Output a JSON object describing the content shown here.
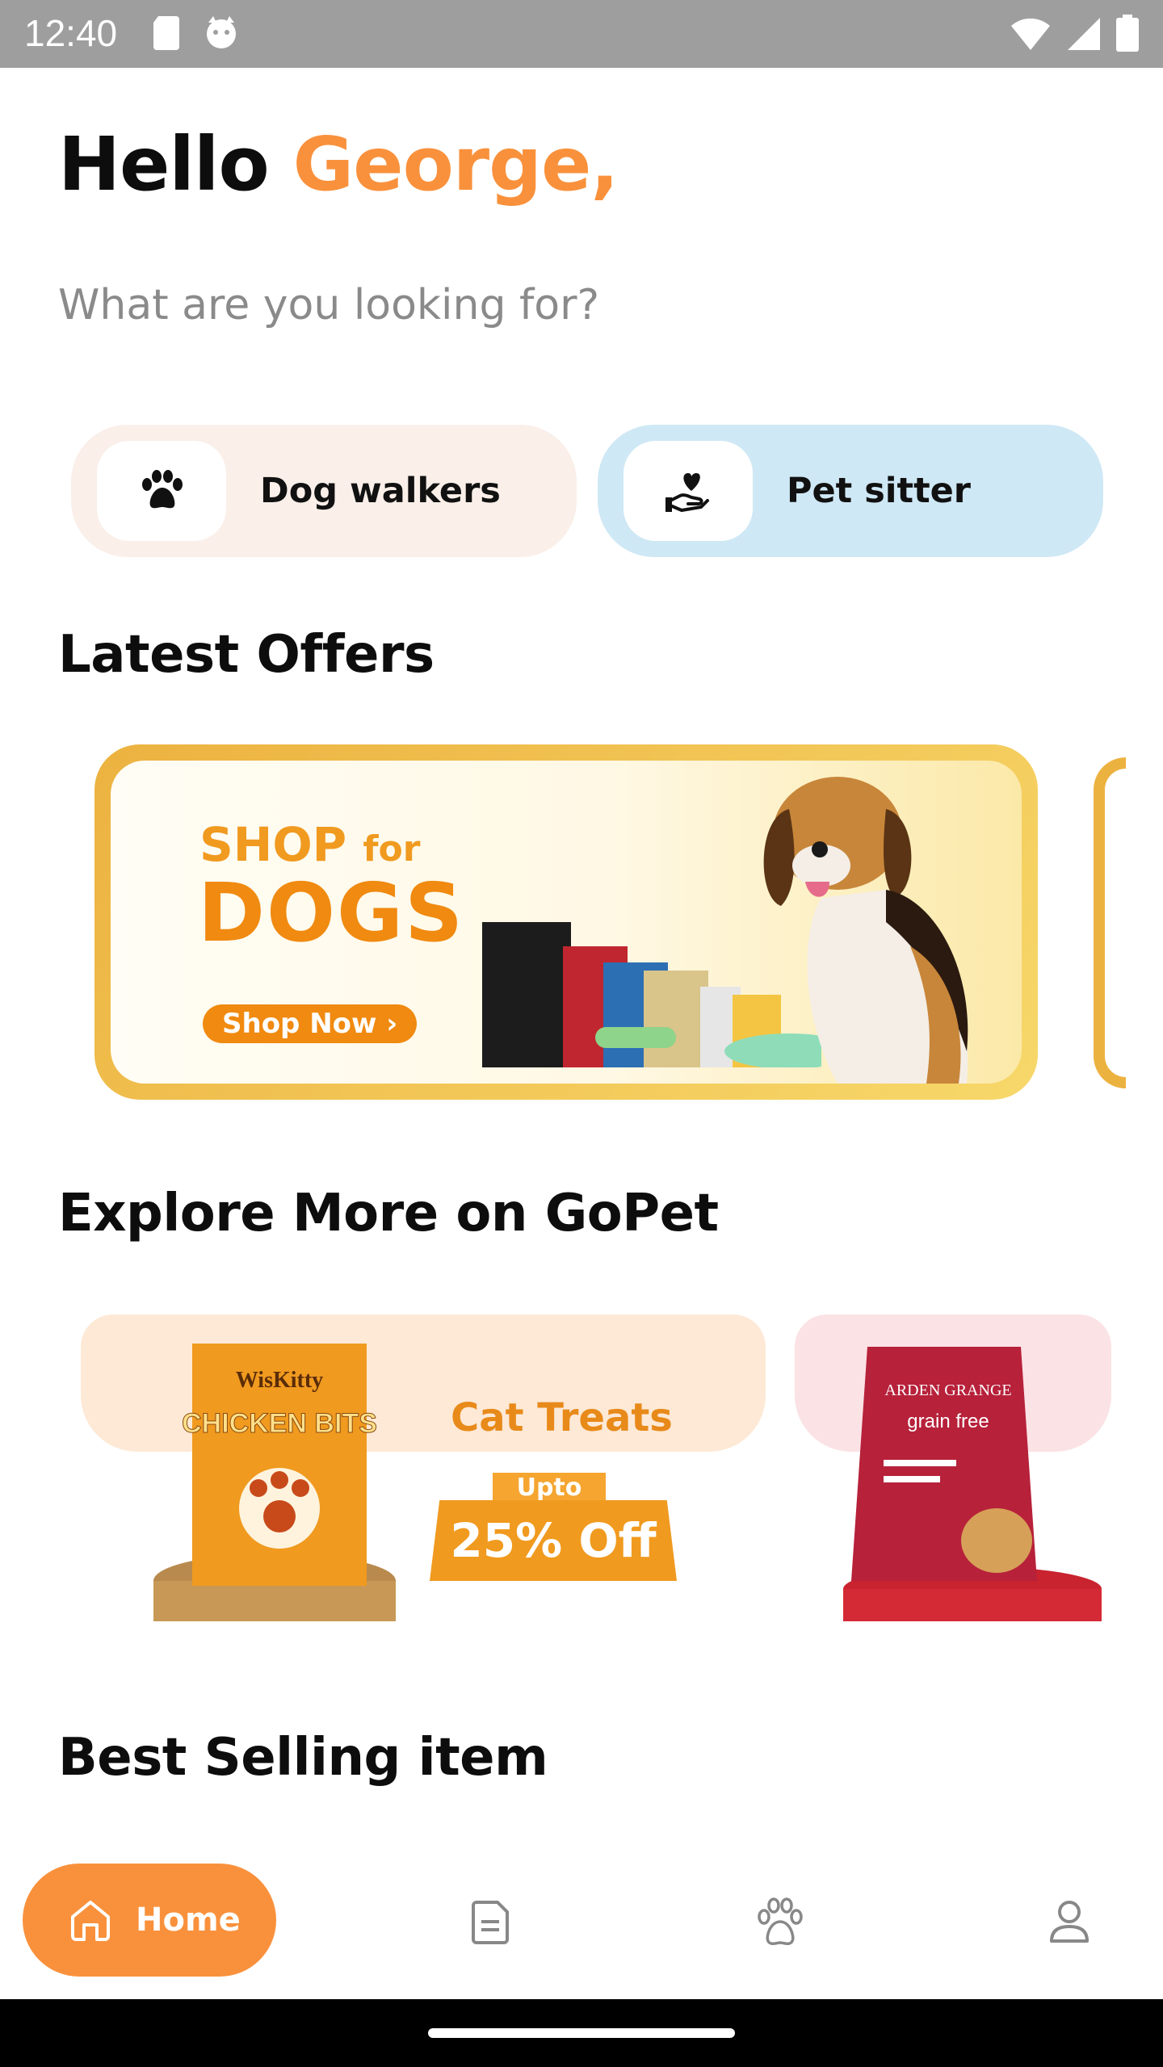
{
  "status_bar": {
    "time": "12:40",
    "icons": [
      "sd-card-icon",
      "cat-face-icon",
      "wifi-icon",
      "signal-icon",
      "battery-icon"
    ]
  },
  "greeting": {
    "hello": "Hello",
    "name": "George,"
  },
  "subtitle": "What are you looking for?",
  "categories": [
    {
      "label": "Dog walkers",
      "icon": "paw-icon"
    },
    {
      "label": "Pet sitter",
      "icon": "heart-hand-icon"
    }
  ],
  "sections": {
    "offers": "Latest Offers",
    "explore": "Explore More on GoPet",
    "best_selling": "Best Selling item"
  },
  "offer_banner": {
    "line1_a": "SHOP",
    "line1_b": "for",
    "line2": "DOGS",
    "cta": "Shop Now ›"
  },
  "explore_cards": [
    {
      "title": "Cat Treats",
      "upto": "Upto",
      "discount": "25% Off",
      "product_brand": "WisKitty",
      "product_name": "CHICKEN BITS"
    },
    {
      "product_brand": "ARDEN GRANGE",
      "product_name": "grain free"
    }
  ],
  "bottom_nav": {
    "home_label": "Home",
    "items": [
      "home-icon",
      "document-icon",
      "paw-icon",
      "profile-icon"
    ]
  },
  "colors": {
    "accent": "#f9913c",
    "dog_card_bg": "#faefe9",
    "sitter_card_bg": "#cfe8f5"
  }
}
